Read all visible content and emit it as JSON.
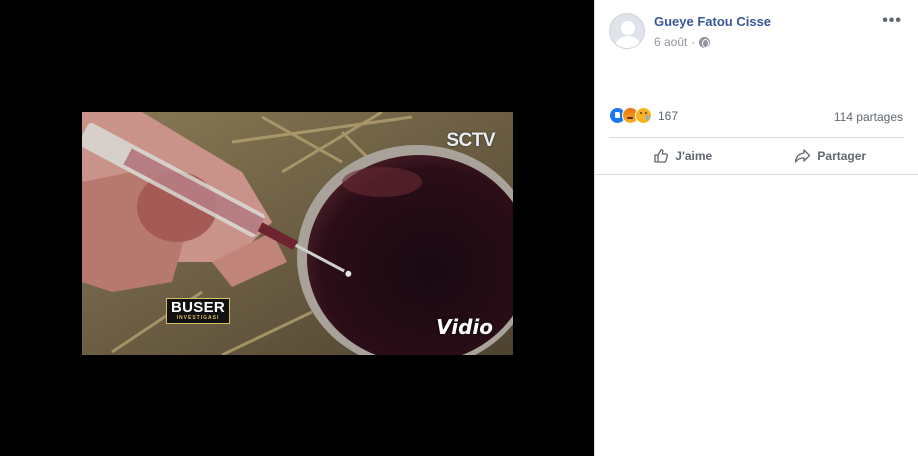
{
  "post": {
    "author": "Gueye Fatou Cisse",
    "date": "6 août",
    "date_separator": "·",
    "audience_icon": "globe-icon",
    "more_label": "•••"
  },
  "media": {
    "watermarks": {
      "channel": "SCTV",
      "platform": "Vidio",
      "program": "BUSER",
      "program_sub": "INVESTIGASI"
    }
  },
  "stats": {
    "reactions": [
      "like",
      "angry",
      "sad"
    ],
    "reaction_count": "167",
    "shares": "114 partages"
  },
  "actions": {
    "like_label": "J'aime",
    "share_label": "Partager"
  },
  "colors": {
    "author_link": "#385898",
    "secondary_text": "#606770",
    "like_blue": "#1877f2",
    "viewer_background": "#000000"
  }
}
